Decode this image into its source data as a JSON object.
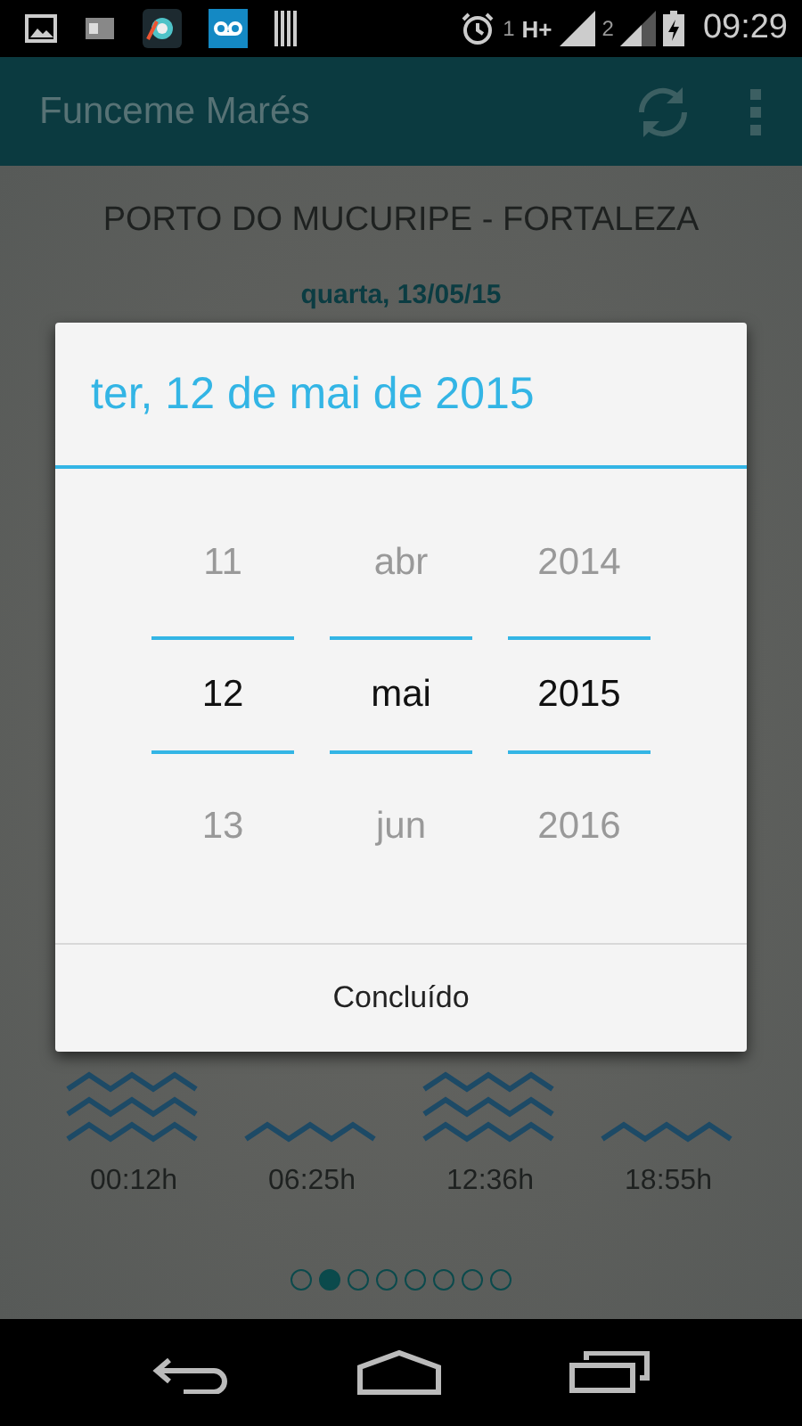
{
  "status_bar": {
    "sim1": "1",
    "network": "H+",
    "sim2": "2",
    "time": "09:29"
  },
  "app_bar": {
    "title": "Funceme Marés"
  },
  "station": "PORTO DO MUCURIPE - FORTALEZA",
  "date": "quarta, 13/05/15",
  "tides": [
    {
      "kind": "high",
      "time": "00:12h"
    },
    {
      "kind": "low",
      "time": "06:25h"
    },
    {
      "kind": "high",
      "time": "12:36h"
    },
    {
      "kind": "low",
      "time": "18:55h"
    }
  ],
  "pager": [
    {
      "selected": false
    },
    {
      "selected": true
    },
    {
      "selected": false
    },
    {
      "selected": false
    },
    {
      "selected": false
    },
    {
      "selected": false
    },
    {
      "selected": false
    },
    {
      "selected": false
    }
  ],
  "dialog": {
    "title": "ter, 12 de mai de 2015",
    "columns": [
      {
        "previous": "11",
        "current": "12",
        "next": "13"
      },
      {
        "previous": "abr",
        "current": "mai",
        "next": "jun"
      },
      {
        "previous": "2014",
        "current": "2015",
        "next": "2016"
      }
    ],
    "button": "Concluído"
  }
}
